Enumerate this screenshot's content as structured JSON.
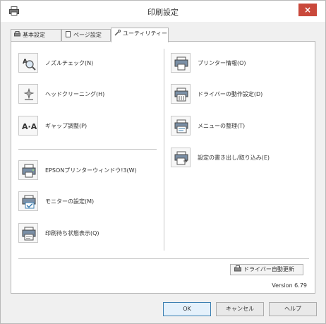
{
  "window": {
    "title": "印刷設定",
    "close_label": "×",
    "close_color": "#c9483b"
  },
  "tabs": [
    {
      "label": "基本設定",
      "icon": "printer-icon",
      "active": false
    },
    {
      "label": "ページ設定",
      "icon": "page-icon",
      "active": false
    },
    {
      "label": "ユーティリティー",
      "icon": "wrench-icon",
      "active": true
    }
  ],
  "utilities": {
    "left": [
      {
        "label": "ノズルチェック(N)",
        "icon": "nozzle-check-icon"
      },
      {
        "label": "ヘッドクリーニング(H)",
        "icon": "head-cleaning-icon"
      },
      {
        "label": "ギャップ調整(P)",
        "icon": "gap-adjust-icon",
        "icon_text": "A·A"
      }
    ],
    "left_lower": [
      {
        "label": "EPSONプリンターウィンドウ!3(W)",
        "icon": "printer-window-icon"
      },
      {
        "label": "モニターの設定(M)",
        "icon": "monitor-settings-icon"
      },
      {
        "label": "印刷待ち状態表示(Q)",
        "icon": "print-queue-icon"
      }
    ],
    "right": [
      {
        "label": "プリンター情報(O)",
        "icon": "printer-info-icon"
      },
      {
        "label": "ドライバーの動作設定(D)",
        "icon": "driver-settings-icon"
      },
      {
        "label": "メニューの整理(T)",
        "icon": "menu-arrange-icon"
      },
      {
        "label": "設定の書き出し/取り込み(E)",
        "icon": "export-import-icon"
      }
    ]
  },
  "driver_update": {
    "label": "ドライバー自動更新",
    "icon": "update-icon"
  },
  "version": "Version 6.79",
  "buttons": {
    "ok": "OK",
    "cancel": "キャンセル",
    "help": "ヘルプ"
  }
}
